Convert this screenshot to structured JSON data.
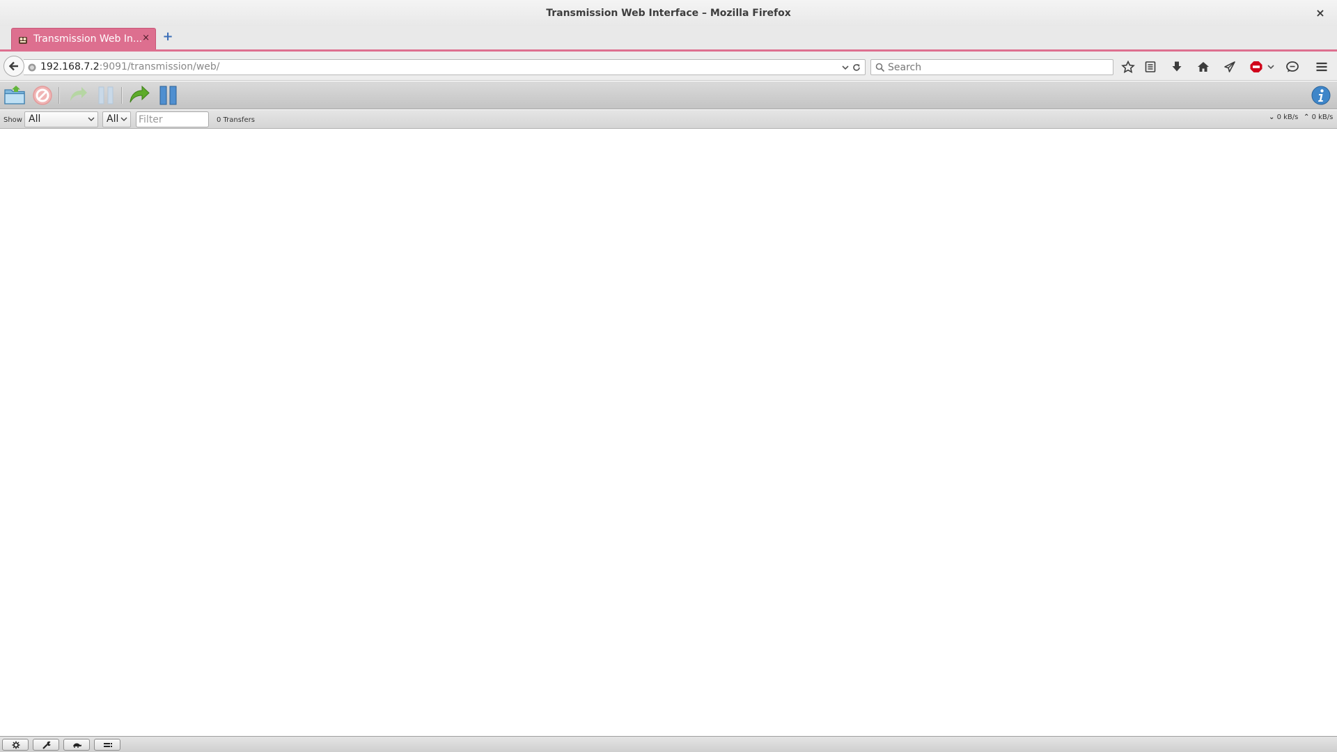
{
  "window": {
    "title": "Transmission Web Interface – Mozilla Firefox",
    "close_glyph": "×"
  },
  "tabs": [
    {
      "label": "Transmission Web In...",
      "close_glyph": "×",
      "active": true
    }
  ],
  "new_tab_glyph": "+",
  "accent_color": "#dd6f8f",
  "nav": {
    "url_host": "192.168.7.2",
    "url_path": ":9091/transmission/web/",
    "search_placeholder": "Search",
    "icons": [
      "back-icon",
      "globe-icon",
      "dropdown-icon",
      "reload-icon",
      "search-icon",
      "bookmark-star-icon",
      "reading-list-icon",
      "download-icon",
      "home-icon",
      "send-icon",
      "adblock-icon",
      "chevron-down-icon",
      "chat-icon",
      "hamburger-menu-icon"
    ]
  },
  "toolbar": {
    "buttons": [
      "open-torrent",
      "remove-torrent",
      "resume-torrent",
      "pause-torrent",
      "resume-all",
      "pause-all"
    ],
    "info_icon": "info-icon"
  },
  "filterbar": {
    "show_label": "Show",
    "state_filter_value": "All",
    "tracker_filter_value": "All",
    "filter_placeholder": "Filter",
    "transfer_count": "0 Transfers",
    "download_speed": "0 kB/s",
    "upload_speed": "0 kB/s"
  },
  "bottombar": {
    "buttons": [
      "settings-gear-icon",
      "preferences-wrench-icon",
      "turtle-speed-icon",
      "compact-view-icon"
    ]
  }
}
